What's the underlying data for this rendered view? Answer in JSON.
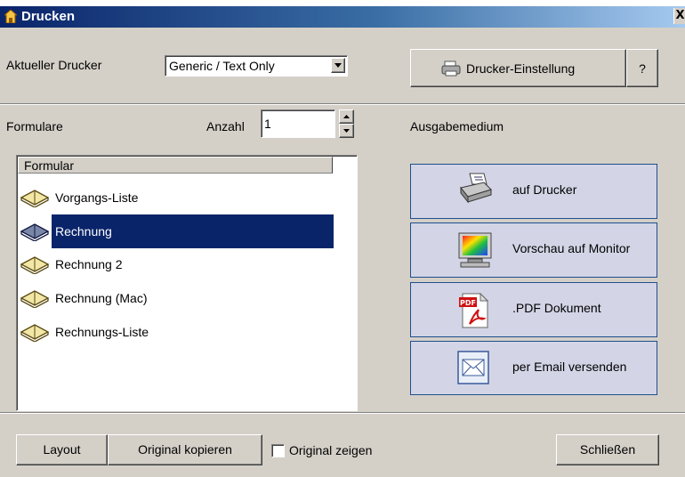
{
  "window": {
    "title": "Drucken",
    "close_glyph": "X"
  },
  "printer": {
    "label": "Aktueller Drucker",
    "selected": "Generic / Text Only",
    "settings_button": "Drucker-Einstellung",
    "help_button": "?"
  },
  "forms": {
    "label": "Formulare",
    "count_label": "Anzahl",
    "count_value": "1",
    "column_header": "Formular",
    "items": [
      {
        "label": "Vorgangs-Liste",
        "selected": false
      },
      {
        "label": "Rechnung",
        "selected": true
      },
      {
        "label": "Rechnung 2",
        "selected": false
      },
      {
        "label": "Rechnung (Mac)",
        "selected": false
      },
      {
        "label": "Rechnungs-Liste",
        "selected": false
      }
    ]
  },
  "output": {
    "label": "Ausgabemedium",
    "buttons": [
      {
        "label": "auf Drucker",
        "icon": "printer-icon"
      },
      {
        "label": "Vorschau auf Monitor",
        "icon": "monitor-icon"
      },
      {
        "label": ".PDF Dokument",
        "icon": "pdf-icon"
      },
      {
        "label": "per Email versenden",
        "icon": "envelope-icon"
      }
    ]
  },
  "footer": {
    "layout_button": "Layout",
    "copy_button": "Original kopieren",
    "show_original_label": "Original zeigen",
    "show_original_checked": false,
    "close_button": "Schließen"
  },
  "colors": {
    "selection": "#0a246a",
    "dialog_bg": "#d4d0c8",
    "media_button_bg": "#d3d5e6",
    "media_button_border": "#1f4e8c"
  }
}
